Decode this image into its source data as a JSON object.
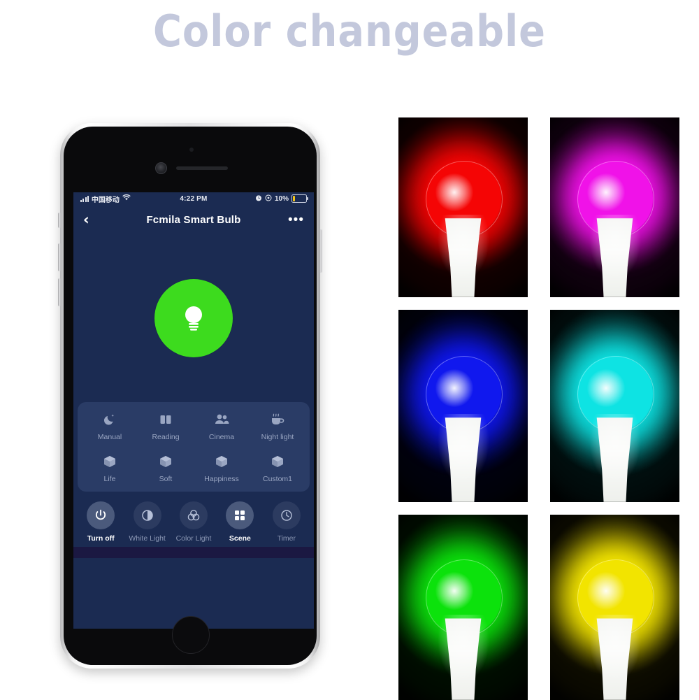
{
  "headline": "Color changeable",
  "phone": {
    "status_bar": {
      "carrier": "中国移动",
      "time": "4:22 PM",
      "battery_percent": "10%",
      "signal_icon": "signal-bars-icon",
      "wifi_icon": "wifi-icon",
      "alarm_icon": "alarm-clock-icon",
      "rotation_lock_icon": "rotation-lock-icon",
      "battery_icon": "battery-low-icon"
    },
    "nav": {
      "back_icon": "chevron-left-icon",
      "title": "Fcmila Smart Bulb",
      "more_icon": "more-options-icon",
      "more_glyph": "•••"
    },
    "power_toggle": {
      "icon": "light-bulb-icon",
      "state_color": "#3ddb1e"
    },
    "scenes": [
      {
        "label": "Manual",
        "icon": "crescent-moon-icon"
      },
      {
        "label": "Reading",
        "icon": "open-book-icon"
      },
      {
        "label": "Cinema",
        "icon": "people-icon"
      },
      {
        "label": "Night light",
        "icon": "coffee-cup-icon"
      },
      {
        "label": "Life",
        "icon": "cube-icon"
      },
      {
        "label": "Soft",
        "icon": "cube-icon"
      },
      {
        "label": "Happiness",
        "icon": "cube-icon"
      },
      {
        "label": "Custom1",
        "icon": "cube-icon"
      }
    ],
    "toolbar": [
      {
        "label": "Turn off",
        "icon": "power-icon",
        "active": true
      },
      {
        "label": "White Light",
        "icon": "brightness-contrast-icon",
        "active": false
      },
      {
        "label": "Color Light",
        "icon": "color-wheel-icon",
        "active": false
      },
      {
        "label": "Scene",
        "icon": "grid-icon",
        "active": true
      },
      {
        "label": "Timer",
        "icon": "clock-icon",
        "active": false
      }
    ],
    "theme": {
      "app_background": "#1b2b52",
      "panel_background": "#2a3c66",
      "accent_on": "#3ddb1e"
    }
  },
  "color_tiles": [
    {
      "name": "red-bulb-tile",
      "color": "#f50505",
      "glow": "#c00000"
    },
    {
      "name": "magenta-bulb-tile",
      "color": "#f012e8",
      "glow": "#9b0d90"
    },
    {
      "name": "blue-bulb-tile",
      "color": "#1018ee",
      "glow": "#0a1290"
    },
    {
      "name": "cyan-bulb-tile",
      "color": "#0ee3e3",
      "glow": "#0a9a9a"
    },
    {
      "name": "green-bulb-tile",
      "color": "#0ce20c",
      "glow": "#0a8f0a"
    },
    {
      "name": "yellow-bulb-tile",
      "color": "#f2e400",
      "glow": "#9c8f00"
    }
  ]
}
